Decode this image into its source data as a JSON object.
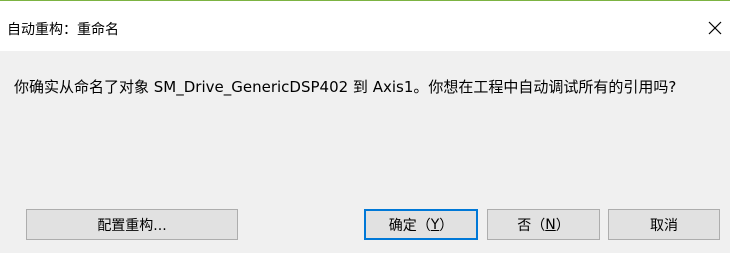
{
  "window": {
    "title": "自动重构：重命名",
    "close_icon": "close-icon"
  },
  "message": {
    "part1": "你确实从命名了对象 ",
    "object_name": "SM_Drive_GenericDSP402",
    "part2": " 到 ",
    "new_name": "Axis1",
    "part3": "。你想在工程中自动调试所有的引用吗?"
  },
  "buttons": {
    "configure": {
      "label": "配置重构..."
    },
    "ok": {
      "label_prefix": "确定（",
      "mnemonic": "Y",
      "label_suffix": "）"
    },
    "no": {
      "label_prefix": "否（",
      "mnemonic": "N",
      "label_suffix": "）"
    },
    "cancel": {
      "label": "取消"
    }
  },
  "colors": {
    "accent": "#7cb342",
    "default_button_border": "#0078d7",
    "button_face": "#e1e1e1",
    "dialog_background": "#f0f0f0"
  }
}
